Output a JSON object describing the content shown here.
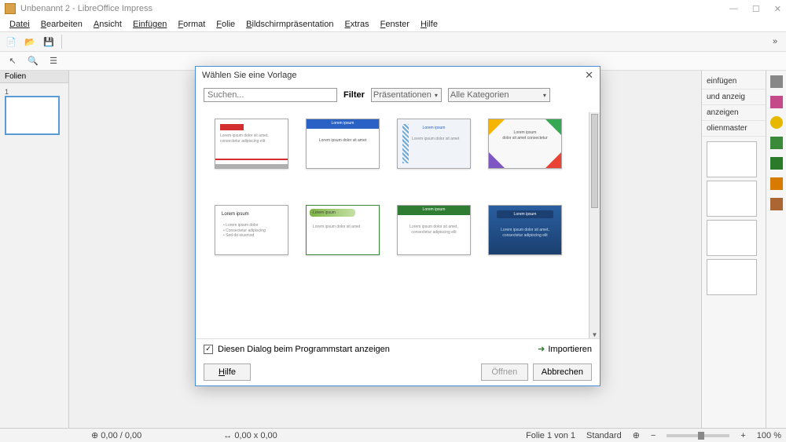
{
  "window": {
    "title": "Unbenannt 2 - LibreOffice Impress",
    "min": "—",
    "max": "☐",
    "close": "✕"
  },
  "menu": [
    "Datei",
    "Bearbeiten",
    "Ansicht",
    "Einfügen",
    "Format",
    "Folie",
    "Bildschirmpräsentation",
    "Extras",
    "Fenster",
    "Hilfe"
  ],
  "slides_panel": {
    "header": "Folien",
    "slide_num": "1"
  },
  "task_pane": {
    "items": [
      "einfügen",
      "und anzeig",
      "anzeigen",
      "olienmaster"
    ]
  },
  "statusbar": {
    "pos": "0,00 / 0,00",
    "size": "0,00 x 0,00",
    "slide": "Folie 1 von 1",
    "std": "Standard",
    "zoom": "100 %"
  },
  "modal": {
    "title": "Wählen Sie eine Vorlage",
    "search_placeholder": "Suchen...",
    "filter_label": "Filter",
    "filter_value": "Präsentationen",
    "category_value": "Alle Kategorien",
    "show_on_start": "Diesen Dialog beim Programmstart anzeigen",
    "import": "Importieren",
    "help": "Hilfe",
    "open": "Öffnen",
    "cancel": "Abbrechen",
    "templates": [
      {
        "title": "Lorem ipsum"
      },
      {
        "title": "Lorem ipsum"
      },
      {
        "title": "Lorem ipsum"
      },
      {
        "title": "Lorem ipsum"
      },
      {
        "title": "Lorem ipsum"
      },
      {
        "title": "Lorem ipsum"
      },
      {
        "title": "Lorem ipsum"
      },
      {
        "title": "Lorem ipsum"
      }
    ]
  },
  "toolbar_overflow": "»"
}
